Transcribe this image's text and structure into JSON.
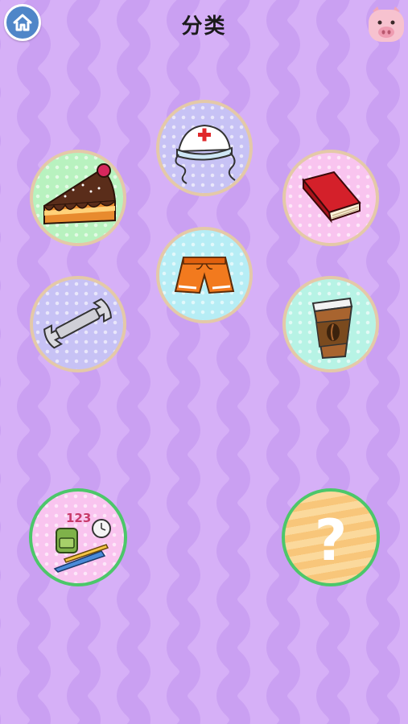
{
  "header": {
    "title": "分类",
    "home_icon": "home-icon",
    "profile_icon": "pig-face-icon"
  },
  "theme": {
    "background": "#d6b0f7",
    "wave_stripe": "#cfa6f4",
    "ring": "#e4c9a8",
    "action_ring": "#4cc76a",
    "home_button": "#4f86c8"
  },
  "items": [
    {
      "name": "nurse-cap",
      "icon": "nurse-cap-icon"
    },
    {
      "name": "cake",
      "icon": "cake-slice-icon"
    },
    {
      "name": "book",
      "icon": "book-icon"
    },
    {
      "name": "shorts",
      "icon": "shorts-icon"
    },
    {
      "name": "wrench",
      "icon": "wrench-icon"
    },
    {
      "name": "coffee",
      "icon": "coffee-cup-icon"
    }
  ],
  "actions": {
    "school": {
      "icon": "school-supplies-icon",
      "badge_text": "123"
    },
    "random": {
      "icon": "question-mark-icon",
      "symbol": "?"
    }
  }
}
